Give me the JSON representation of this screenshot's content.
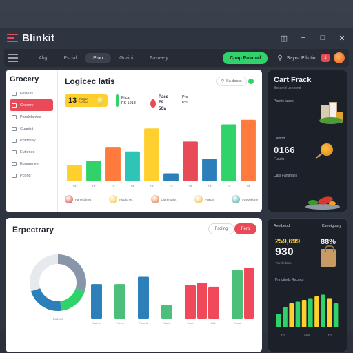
{
  "app": {
    "title": "Blinkit"
  },
  "window_controls": [
    "share-icon",
    "minimize-icon",
    "maximize-icon",
    "close-icon"
  ],
  "nav": {
    "tabs": [
      "Ahg",
      "Pscial",
      "Pioo",
      "Gcaioi",
      "Fasreely"
    ],
    "active_tab": 2,
    "cta_label": "Cpap Paiotud",
    "search_label": "Sayoz Plllotinr",
    "badge": "1"
  },
  "grocery": {
    "sidebar_title": "Grocery",
    "sidebar_items": [
      {
        "label": "Fusiess",
        "active": false
      },
      {
        "label": "Grocery",
        "active": true
      },
      {
        "label": "Pandolantes",
        "active": false
      },
      {
        "label": "Cuantnt",
        "active": false
      },
      {
        "label": "Pntlfiteay",
        "active": false
      },
      {
        "label": "Eutlenes",
        "active": false
      },
      {
        "label": "Eqnarenes",
        "active": false
      },
      {
        "label": "Pcond",
        "active": false
      }
    ],
    "content_title": "Logicec latis",
    "search_label": "Sa daccs",
    "stat_yellow": {
      "value": "13",
      "label": "Fagar Vomie"
    },
    "stat_mid": {
      "line1": "Fiica",
      "line2": "FS 1913"
    },
    "stat_drop": {
      "line1": "Pacs",
      "line2": "F9",
      "line3": "5Ca"
    },
    "stat_right": {
      "line1": "Prs",
      "line2": "Pcl"
    },
    "legend": [
      "Fanesbines",
      "Fiadicnes",
      "Clgremaibs",
      "Fgepn",
      "Faeuebone"
    ]
  },
  "chart_data": [
    {
      "type": "bar",
      "title": "Logicec latis",
      "categories": [
        "Fa",
        "Fa",
        "Fa",
        "Fa",
        "Fa",
        "Fa",
        "Fa",
        "Fa",
        "Fa",
        "Fa",
        "Fa"
      ],
      "values": [
        25,
        31,
        52,
        45,
        80,
        12,
        60,
        34,
        86,
        93
      ],
      "colors": [
        "#ffcf2e",
        "#2fd36a",
        "#ff7a3d",
        "#2ec4b6",
        "#ffcf2e",
        "#2c7fb8",
        "#e84b57",
        "#2c7fb8",
        "#2fd36a",
        "#ff7a3d"
      ],
      "ylim": [
        0,
        100
      ],
      "grid": false
    },
    {
      "type": "pie",
      "title": "Erpectrary",
      "values": [
        30,
        18,
        22,
        30
      ],
      "colors": [
        "#8796a8",
        "#2fd36a",
        "#2c7fb8",
        "#e6e9ee"
      ]
    },
    {
      "type": "bar",
      "categories": [
        "Fanns",
        "Fanns",
        "Fasonfl",
        "Faos",
        "Faec",
        "Fafls",
        "Fanus"
      ],
      "values": [
        52,
        52,
        63,
        20,
        50,
        48,
        73
      ],
      "second_values": [
        0,
        0,
        0,
        0,
        54,
        0,
        77
      ],
      "colors": [
        "#2c7fb8",
        "#4ebf7a",
        "#2c7fb8",
        "#4ebf7a",
        "#f04a5a",
        "#f04a5a",
        "#4ebf7a"
      ],
      "ylim": [
        0,
        100
      ]
    },
    {
      "type": "bar",
      "title": "Prinotteds Recrrcd",
      "values": [
        40,
        60,
        70,
        75,
        80,
        85,
        90,
        95,
        85,
        70
      ],
      "colors": [
        "#2fd36a",
        "#2fd36a",
        "#ffcf2e",
        "#2fd36a",
        "#ffcf2e",
        "#2fd36a",
        "#ffcf2e",
        "#2fd36a",
        "#ffcf2e",
        "#2fd36a"
      ],
      "ylim": [
        0,
        100
      ]
    }
  ],
  "cart": {
    "title": "Cart Frack",
    "subtitle": "Bocared uonoond",
    "row1": "Pauvis luaoo",
    "row2": "Ceinrtd",
    "big_number": "0166",
    "row3": "Fuaots",
    "row4": "Cars Fanahaes"
  },
  "expectary": {
    "title": "Erpectrary",
    "btn_outline": "Fscling",
    "btn_red": "Ferp",
    "pie_label": "Sosces"
  },
  "stats": {
    "head_left": "Avotbeod",
    "head_right": "Caeotgoury",
    "num1": "259,699",
    "num2": "930",
    "sub": "Tioreleddes",
    "pct": "88%",
    "bar_title": "Prinotteds Recrrcd",
    "bar_footer": [
      "Frs",
      "Cns",
      "Frs"
    ]
  }
}
